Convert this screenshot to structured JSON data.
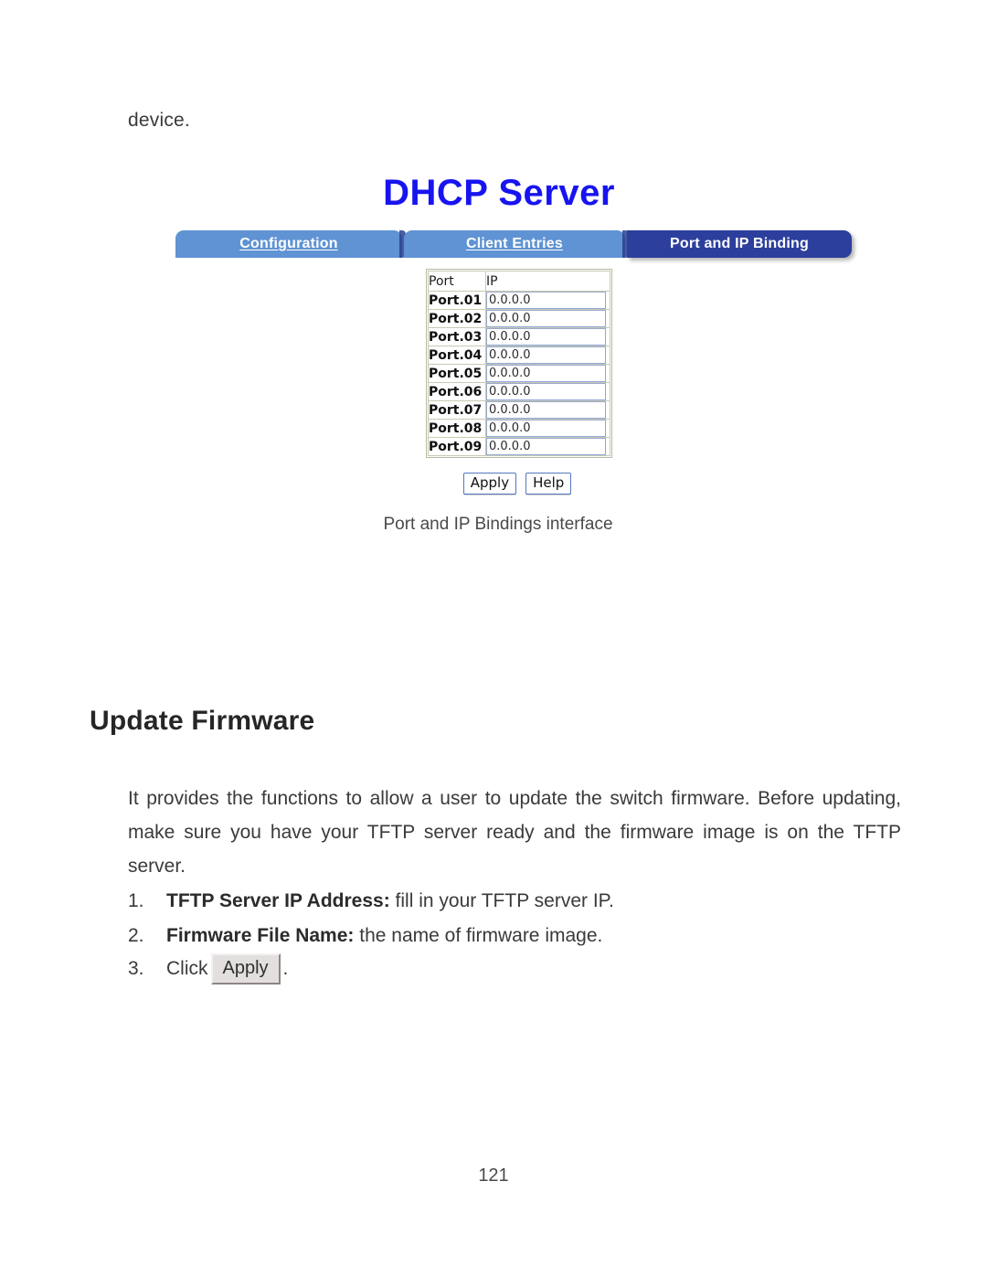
{
  "document": {
    "continuation_text": "device.",
    "page_number": "121"
  },
  "ui_figure": {
    "title": "DHCP Server",
    "title_color": "#1714f0",
    "tabs": [
      {
        "label": "Configuration",
        "active": false
      },
      {
        "label": "Client Entries",
        "active": false
      },
      {
        "label": "Port and IP Binding",
        "active": true
      }
    ],
    "tab_colors": {
      "inactive": "#5f93d3",
      "active": "#2c3f9c",
      "label": "#ffffff"
    },
    "table": {
      "headers": [
        "Port",
        "IP"
      ],
      "rows": [
        {
          "port": "Port.01",
          "ip": "0.0.0.0"
        },
        {
          "port": "Port.02",
          "ip": "0.0.0.0"
        },
        {
          "port": "Port.03",
          "ip": "0.0.0.0"
        },
        {
          "port": "Port.04",
          "ip": "0.0.0.0"
        },
        {
          "port": "Port.05",
          "ip": "0.0.0.0"
        },
        {
          "port": "Port.06",
          "ip": "0.0.0.0"
        },
        {
          "port": "Port.07",
          "ip": "0.0.0.0"
        },
        {
          "port": "Port.08",
          "ip": "0.0.0.0"
        },
        {
          "port": "Port.09",
          "ip": "0.0.0.0"
        }
      ]
    },
    "buttons": {
      "apply": "Apply",
      "help": "Help"
    },
    "caption": "Port and IP Bindings interface"
  },
  "section": {
    "heading": "Update Firmware",
    "paragraph": "It provides the functions to allow a user to update the switch firmware. Before updating, make sure you have your TFTP server ready and the firmware image is on the TFTP server.",
    "steps": [
      {
        "marker": "1.",
        "bold": "TFTP Server IP Address:",
        "rest": " fill in your TFTP server IP."
      },
      {
        "marker": "2.",
        "bold": "Firmware File Name:",
        "rest": " the name of firmware image."
      },
      {
        "marker": "3.",
        "prefix": "Click",
        "button": "Apply",
        "suffix": "."
      }
    ]
  }
}
